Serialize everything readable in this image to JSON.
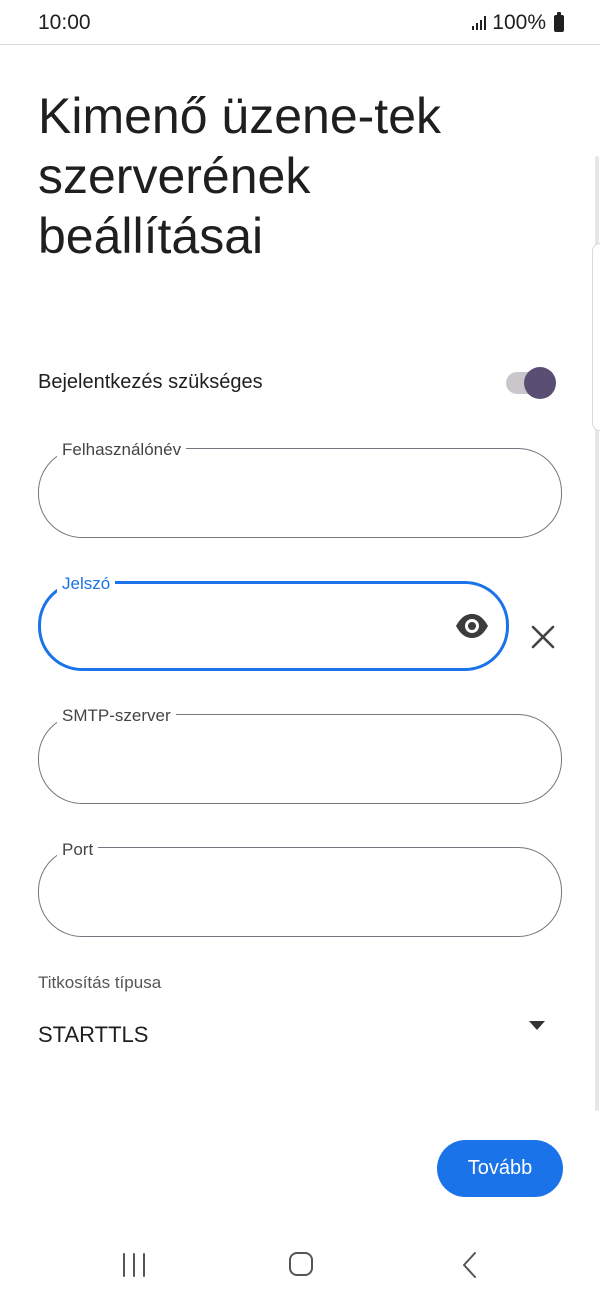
{
  "status_bar": {
    "time": "10:00",
    "battery": "100%"
  },
  "page": {
    "title": "Kimenő üzene-tek szerverének beállításai"
  },
  "login_required": {
    "label": "Bejelentkezés szükséges",
    "enabled": true
  },
  "fields": {
    "username": {
      "label": "Felhasználónév",
      "value": ""
    },
    "password": {
      "label": "Jelszó",
      "value": "",
      "focused": true
    },
    "smtp_server": {
      "label": "SMTP-szerver",
      "value": ""
    },
    "port": {
      "label": "Port",
      "value": ""
    }
  },
  "encryption": {
    "label": "Titkosítás típusa",
    "value": "STARTTLS"
  },
  "actions": {
    "next_label": "Tovább"
  },
  "icons": {
    "password_visibility": "eye-icon",
    "clear_password": "close-icon",
    "nav_recents": "recents-icon",
    "nav_home": "home-icon",
    "nav_back": "back-icon"
  },
  "colors": {
    "accent": "#1a73e8",
    "toggle_thumb": "#5a4f73",
    "outline": "#74777f"
  }
}
